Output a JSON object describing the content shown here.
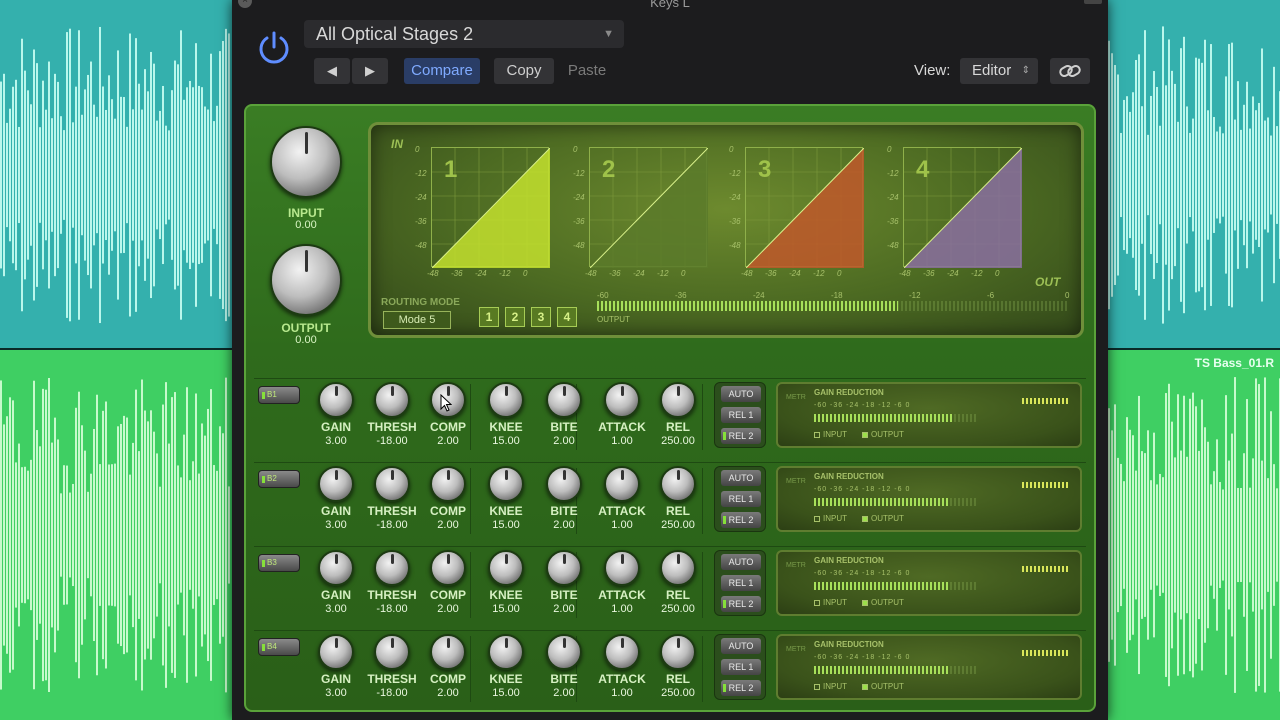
{
  "window": {
    "title": "Keys L"
  },
  "background": {
    "track_name": "TS Bass_01.R",
    "top_color": "#34b0ad",
    "bottom_color": "#3fcf63"
  },
  "header": {
    "preset": "All Optical Stages 2",
    "prev_icon": "prev-arrow-icon",
    "next_icon": "next-arrow-icon",
    "compare_label": "Compare",
    "copy_label": "Copy",
    "paste_label": "Paste",
    "view_label": "View:",
    "view_value": "Editor",
    "power_icon": "power-icon",
    "link_icon": "link-icon"
  },
  "master": {
    "input_label": "INPUT",
    "input_value": "0.00",
    "output_label": "OUTPUT",
    "output_value": "0.00"
  },
  "screen": {
    "in_label": "IN",
    "out_label": "OUT",
    "graphs": [
      {
        "number": "1",
        "fill": "#c3e02e"
      },
      {
        "number": "2",
        "fill": "#5b7a2a"
      },
      {
        "number": "3",
        "fill": "#c0582a"
      },
      {
        "number": "4",
        "fill": "#8a6fa0"
      }
    ],
    "y_ticks": [
      "0",
      "-12",
      "-24",
      "-36",
      "-48"
    ],
    "x_ticks": [
      "-48",
      "-36",
      "-24",
      "-12",
      "0"
    ],
    "routing_label": "ROUTING MODE",
    "mode": "Mode 5",
    "route_buttons": [
      "1",
      "2",
      "3",
      "4"
    ],
    "output_meter_label": "OUTPUT",
    "output_scale": [
      "-60",
      "-36",
      "-24",
      "-18",
      "-12",
      "-6",
      "0"
    ],
    "output_level": 0.64
  },
  "bands": [
    {
      "button": "B1",
      "knobs": [
        {
          "label": "GAIN",
          "value": "3.00"
        },
        {
          "label": "THRESH",
          "value": "-18.00"
        },
        {
          "label": "COMP",
          "value": "2.00"
        },
        {
          "label": "KNEE",
          "value": "15.00"
        },
        {
          "label": "BITE",
          "value": "2.00"
        },
        {
          "label": "ATTACK",
          "value": "1.00"
        },
        {
          "label": "REL",
          "value": "250.00"
        }
      ],
      "rel_buttons": [
        "AUTO",
        "REL 1",
        "REL 2"
      ],
      "gr_level": 0.85
    },
    {
      "button": "B2",
      "knobs": [
        {
          "label": "GAIN",
          "value": "3.00"
        },
        {
          "label": "THRESH",
          "value": "-18.00"
        },
        {
          "label": "COMP",
          "value": "2.00"
        },
        {
          "label": "KNEE",
          "value": "15.00"
        },
        {
          "label": "BITE",
          "value": "2.00"
        },
        {
          "label": "ATTACK",
          "value": "1.00"
        },
        {
          "label": "REL",
          "value": "250.00"
        }
      ],
      "rel_buttons": [
        "AUTO",
        "REL 1",
        "REL 2"
      ],
      "gr_level": 0.82
    },
    {
      "button": "B3",
      "knobs": [
        {
          "label": "GAIN",
          "value": "3.00"
        },
        {
          "label": "THRESH",
          "value": "-18.00"
        },
        {
          "label": "COMP",
          "value": "2.00"
        },
        {
          "label": "KNEE",
          "value": "15.00"
        },
        {
          "label": "BITE",
          "value": "2.00"
        },
        {
          "label": "ATTACK",
          "value": "1.00"
        },
        {
          "label": "REL",
          "value": "250.00"
        }
      ],
      "rel_buttons": [
        "AUTO",
        "REL 1",
        "REL 2"
      ],
      "gr_level": 0.82
    },
    {
      "button": "B4",
      "knobs": [
        {
          "label": "GAIN",
          "value": "3.00"
        },
        {
          "label": "THRESH",
          "value": "-18.00"
        },
        {
          "label": "COMP",
          "value": "2.00"
        },
        {
          "label": "KNEE",
          "value": "15.00"
        },
        {
          "label": "BITE",
          "value": "2.00"
        },
        {
          "label": "ATTACK",
          "value": "1.00"
        },
        {
          "label": "REL",
          "value": "250.00"
        }
      ],
      "rel_buttons": [
        "AUTO",
        "REL 1",
        "REL 2"
      ],
      "gr_level": 0.82
    }
  ],
  "gr_display": {
    "title": "GAIN REDUCTION",
    "side_label": "METR",
    "scale": "-60 -36 -24 -18 -12 -6 0",
    "input_label": "INPUT",
    "output_label": "OUTPUT"
  }
}
